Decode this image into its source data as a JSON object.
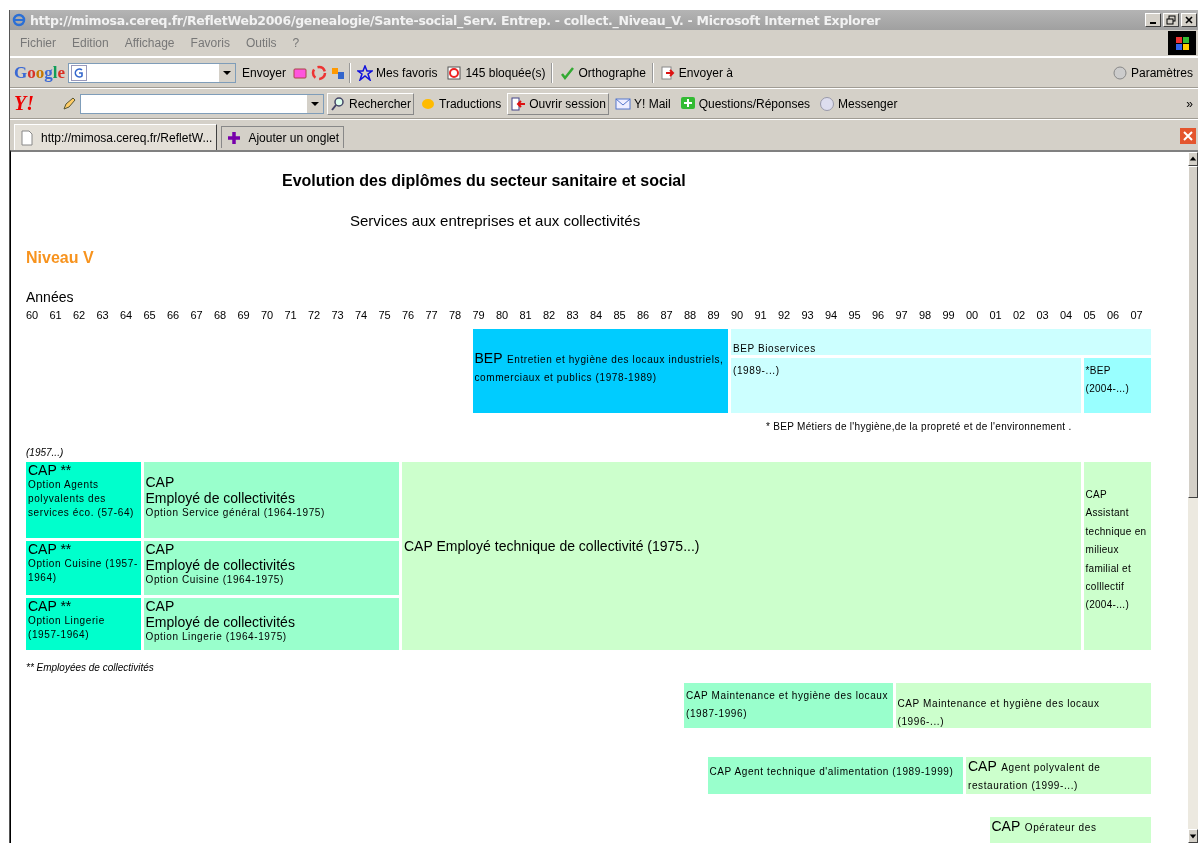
{
  "window": {
    "title": "http://mimosa.cereq.fr/RefletWeb2006/genealogie/Sante-social_Serv. Entrep. - collect._Niveau_V. - Microsoft Internet Explorer"
  },
  "menu": [
    "Fichier",
    "Edition",
    "Affichage",
    "Favoris",
    "Outils",
    "?"
  ],
  "google_toolbar": {
    "logo": "Google",
    "send": "Envoyer",
    "favorites": "Mes favoris",
    "blocked": "145 bloquée(s)",
    "spelling": "Orthographe",
    "send_to": "Envoyer à",
    "settings": "Paramètres"
  },
  "yahoo_toolbar": {
    "logo": "Y!",
    "search": "Rechercher",
    "translations": "Traductions",
    "sign_in": "Ouvrir session",
    "mail": "Y! Mail",
    "answers": "Questions/Réponses",
    "messenger": "Messenger",
    "more": "»"
  },
  "tabs": [
    {
      "label": "http://mimosa.cereq.fr/RefletW...",
      "selected": true
    }
  ],
  "add_tab": "Ajouter un onglet",
  "page": {
    "title": "Evolution des diplômes du secteur sanitaire et social",
    "subtitle": "Services aux entreprises et aux collectivités",
    "level_heading": "Niveau V",
    "years_label": "Années",
    "years": [
      "60",
      "61",
      "62",
      "63",
      "64",
      "65",
      "66",
      "67",
      "68",
      "69",
      "70",
      "71",
      "72",
      "73",
      "74",
      "75",
      "76",
      "77",
      "78",
      "79",
      "80",
      "81",
      "82",
      "83",
      "84",
      "85",
      "86",
      "87",
      "88",
      "89",
      "90",
      "91",
      "92",
      "93",
      "94",
      "95",
      "96",
      "97",
      "98",
      "99",
      "00",
      "01",
      "02",
      "03",
      "04",
      "05",
      "06",
      "07"
    ],
    "rows": [
      {
        "kind": "blocks",
        "blocks": [
          {
            "color": "#00ccff",
            "title": "BEP",
            "detail": "Entretien et hygiène des locaux industriels, commerciaux et publics (1978-1989)"
          },
          {
            "color": "#ccffff",
            "detail": "BEP Bioservices"
          },
          {
            "color": "#ccffff",
            "detail": "(1989-...)"
          },
          {
            "color": "#99ffff",
            "detail": "*BEP (2004-...)"
          }
        ]
      },
      {
        "kind": "note",
        "text": "* BEP Métiers de l'hygiène,de la propreté et de l'environnement ."
      },
      {
        "kind": "caption",
        "text": "(1957...)"
      },
      {
        "kind": "blocks",
        "blocks": [
          {
            "color": "#00ffcc",
            "title": "CAP **",
            "detail": "Option Agents polyvalents des services éco. (57-64)"
          },
          {
            "color": "#99ffcc",
            "title": "CAP",
            "subtitle": "Employé de collectivités",
            "detail": "Option Service général (1964-1975)"
          },
          {
            "color": "#00ffcc",
            "title": "CAP **",
            "detail": "Option Cuisine (1957-1964)"
          },
          {
            "color": "#99ffcc",
            "title": "CAP",
            "subtitle": "Employé de collectivités",
            "detail": "Option Cuisine (1964-1975)"
          },
          {
            "color": "#00ffcc",
            "title": "CAP **",
            "detail": "Option Lingerie (1957-1964)"
          },
          {
            "color": "#99ffcc",
            "title": "CAP",
            "subtitle": "Employé de collectivités",
            "detail": "Option Lingerie (1964-1975)"
          },
          {
            "color": "#ccffcc",
            "title": "CAP Employé technique de collectivité (1975...)"
          },
          {
            "color": "#ccffcc",
            "detail": "CAP Assistant technique en milieux familial et colllectif (2004-...)"
          }
        ]
      },
      {
        "kind": "caption",
        "text": "** Employées de collectivités"
      },
      {
        "kind": "blocks",
        "blocks": [
          {
            "color": "#99ffcc",
            "detail": "CAP Maintenance et hygiène des locaux (1987-1996)"
          },
          {
            "color": "#ccffcc",
            "detail": "CAP Maintenance et hygiène des locaux (1996-...)"
          }
        ]
      },
      {
        "kind": "blocks",
        "blocks": [
          {
            "color": "#99ffcc",
            "detail": "CAP Agent technique d'alimentation (1989-1999)"
          },
          {
            "color": "#ccffcc",
            "title": "CAP",
            "detail": "Agent polyvalent de restauration (1999-...)"
          }
        ]
      },
      {
        "kind": "blocks",
        "blocks": [
          {
            "color": "#ccffcc",
            "title": "CAP",
            "detail": "Opérateur des"
          }
        ]
      }
    ]
  }
}
